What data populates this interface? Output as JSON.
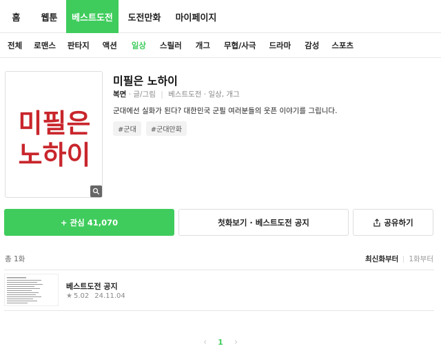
{
  "topnav": {
    "tabs": [
      {
        "label": "홈",
        "active": false
      },
      {
        "label": "웹툰",
        "active": false
      },
      {
        "label": "베스트도전",
        "active": true
      },
      {
        "label": "도전만화",
        "active": false
      },
      {
        "label": "마이페이지",
        "active": false
      }
    ]
  },
  "categories": [
    "전체",
    "로맨스",
    "판타지",
    "액션",
    "일상",
    "스릴러",
    "개그",
    "무협/사극",
    "드라마",
    "감성",
    "스포츠"
  ],
  "active_category": "일상",
  "comic": {
    "title": "미필은 노하이",
    "author": "복면",
    "role": "글/그림",
    "meta_rest": "베스트도전 · 일상, 개그",
    "description": "군대에선 실화가 된다? 대한민국 군필 여러분들의 웃픈 이야기를 그립니다.",
    "tags": [
      "#군대",
      "#군대만화"
    ],
    "cover_text": [
      "미필은",
      "노하이"
    ],
    "cover_color": "#c8262c"
  },
  "actions": {
    "subscribe_label": "+ 관심 41,070",
    "first_ep_label": "첫화보기 · 베스트도전 공지",
    "share_label": "공유하기"
  },
  "list": {
    "total": "총 1화",
    "sort_active": "최신화부터",
    "sort_other": "1화부터",
    "episodes": [
      {
        "title": "베스트도전 공지",
        "rating": "5.02",
        "date": "24.11.04"
      }
    ]
  },
  "pager": {
    "current": "1",
    "prev": "‹",
    "next": "›"
  },
  "colors": {
    "accent": "#3fcc5c"
  }
}
